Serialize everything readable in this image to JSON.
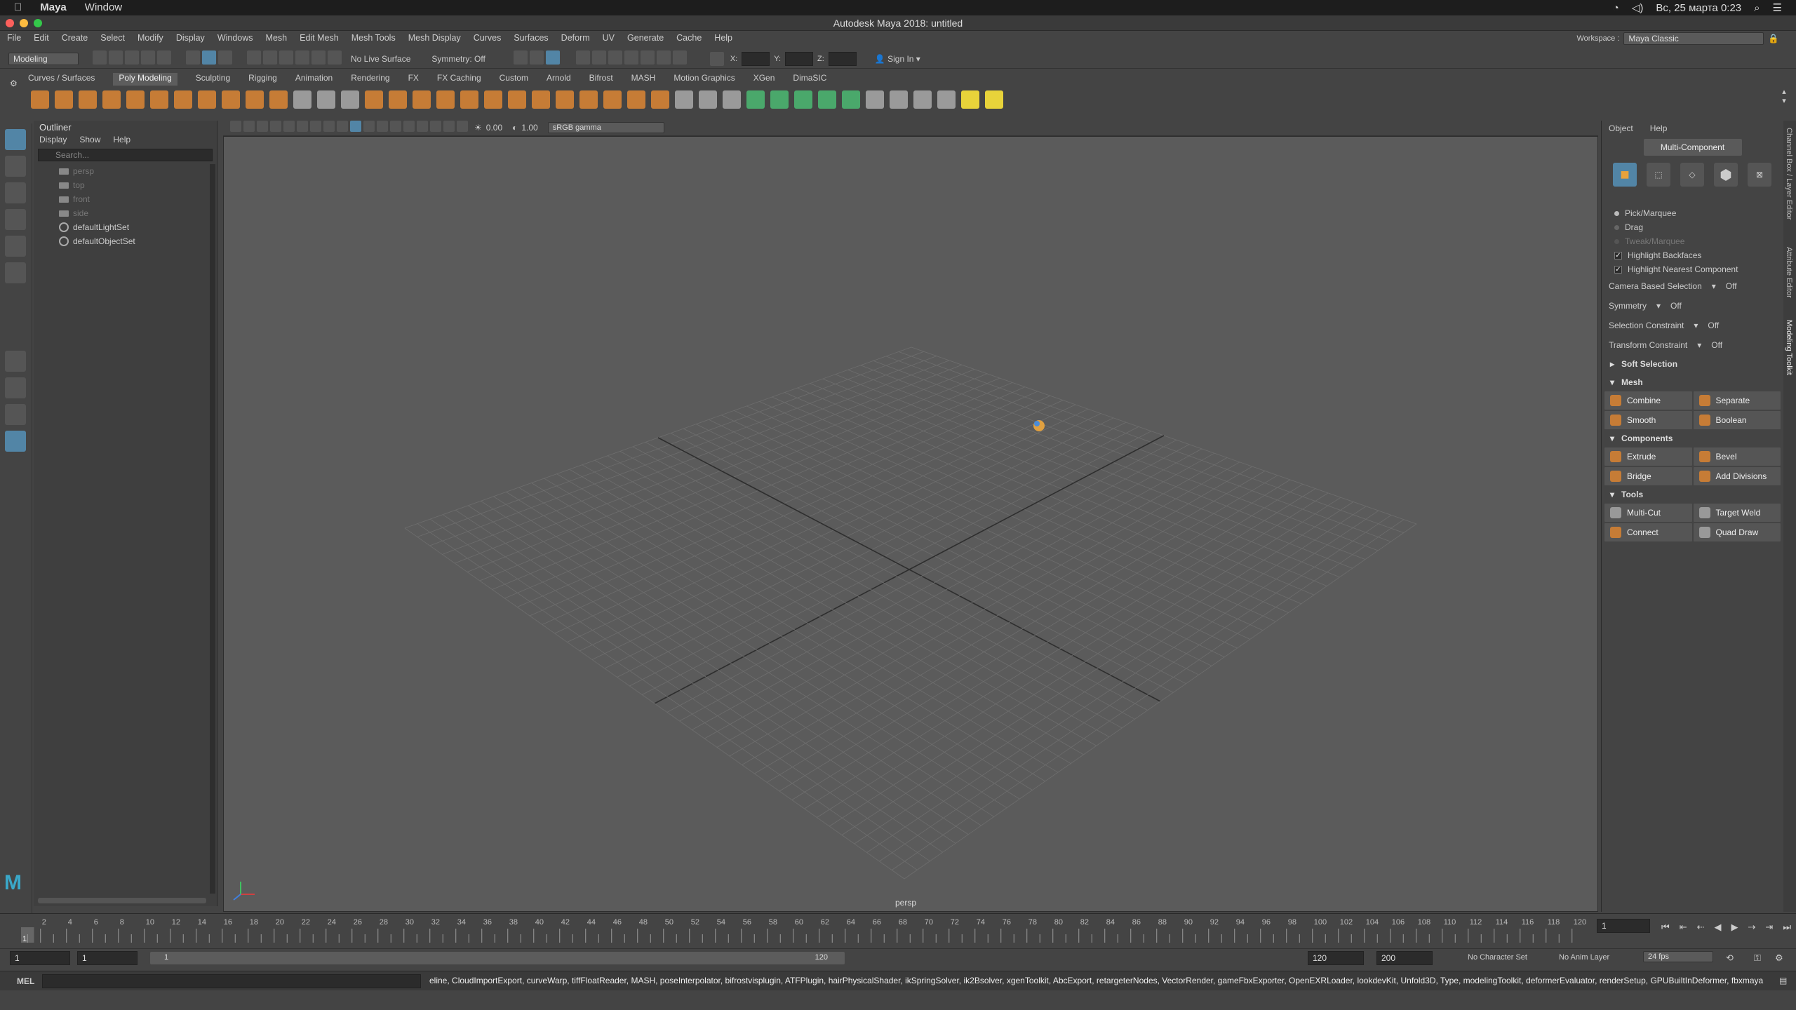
{
  "mac": {
    "app": "Maya",
    "window": "Window",
    "datetime": "Вс, 25 марта 0:23"
  },
  "title": "Autodesk Maya 2018: untitled",
  "menu": [
    "File",
    "Edit",
    "Create",
    "Select",
    "Modify",
    "Display",
    "Windows",
    "Mesh",
    "Edit Mesh",
    "Mesh Tools",
    "Mesh Display",
    "Curves",
    "Surfaces",
    "Deform",
    "UV",
    "Generate",
    "Cache",
    "Help"
  ],
  "workspace": {
    "label": "Workspace :",
    "value": "Maya Classic"
  },
  "status": {
    "mode": "Modeling",
    "live_surface": "No Live Surface",
    "symmetry": "Symmetry: Off",
    "x": "X:",
    "y": "Y:",
    "z": "Z:",
    "sign_in": "Sign In"
  },
  "shelf_tabs": [
    "Curves / Surfaces",
    "Poly Modeling",
    "Sculpting",
    "Rigging",
    "Animation",
    "Rendering",
    "FX",
    "FX Caching",
    "Custom",
    "Arnold",
    "Bifrost",
    "MASH",
    "Motion Graphics",
    "XGen",
    "DimaSIC"
  ],
  "outliner": {
    "title": "Outliner",
    "menu": [
      "Display",
      "Show",
      "Help"
    ],
    "search": "Search...",
    "items": [
      {
        "label": "persp",
        "dim": true,
        "icon": "camera-icon"
      },
      {
        "label": "top",
        "dim": true,
        "icon": "camera-icon"
      },
      {
        "label": "front",
        "dim": true,
        "icon": "camera-icon"
      },
      {
        "label": "side",
        "dim": true,
        "icon": "camera-icon"
      },
      {
        "label": "defaultLightSet",
        "dim": false,
        "icon": "set-icon"
      },
      {
        "label": "defaultObjectSet",
        "dim": false,
        "icon": "set-icon"
      }
    ]
  },
  "viewport": {
    "exposure": "0.00",
    "gamma": "1.00",
    "colorspace": "sRGB gamma",
    "camera": "persp"
  },
  "toolkit": {
    "menu": [
      "Object",
      "Help"
    ],
    "mode": "Multi-Component",
    "selection": [
      "Pick/Marquee",
      "Drag",
      "Tweak/Marquee"
    ],
    "checks": [
      "Highlight Backfaces",
      "Highlight Nearest Component"
    ],
    "settings": [
      {
        "k": "Camera Based Selection",
        "v": "Off"
      },
      {
        "k": "Symmetry",
        "v": "Off"
      },
      {
        "k": "Selection Constraint",
        "v": "Off"
      },
      {
        "k": "Transform Constraint",
        "v": "Off"
      }
    ],
    "soft": "Soft Selection",
    "mesh_title": "Mesh",
    "mesh": [
      "Combine",
      "Separate",
      "Smooth",
      "Boolean"
    ],
    "comp_title": "Components",
    "comp": [
      "Extrude",
      "Bevel",
      "Bridge",
      "Add Divisions"
    ],
    "tools_title": "Tools",
    "tools": [
      "Multi-Cut",
      "Target Weld",
      "Connect",
      "Quad Draw"
    ]
  },
  "sidetabs": [
    "Channel Box / Layer Editor",
    "Attribute Editor",
    "Modeling Toolkit"
  ],
  "time": {
    "ticks": [
      "2",
      "4",
      "6",
      "8",
      "10",
      "12",
      "14",
      "16",
      "18",
      "20",
      "22",
      "24",
      "26",
      "28",
      "30",
      "32",
      "34",
      "36",
      "38",
      "40",
      "42",
      "44",
      "46",
      "48",
      "50",
      "52",
      "54",
      "56",
      "58",
      "60",
      "62",
      "64",
      "66",
      "68",
      "70",
      "72",
      "74",
      "76",
      "78",
      "80",
      "82",
      "84",
      "86",
      "88",
      "90",
      "92",
      "94",
      "96",
      "98",
      "100",
      "102",
      "104",
      "106",
      "108",
      "110",
      "112",
      "114",
      "116",
      "118",
      "120"
    ],
    "current": "1",
    "start": "1",
    "start2": "1",
    "range_start": "1",
    "range_end": "120",
    "end": "120",
    "end2": "200",
    "char_set": "No Character Set",
    "anim_layer": "No Anim Layer",
    "fps": "24 fps"
  },
  "cmd": {
    "lang": "MEL",
    "plugins": "eline, CloudImportExport, curveWarp, tiffFloatReader, MASH, poseInterpolator, bifrostvisplugin, ATFPlugin, hairPhysicalShader, ikSpringSolver, ik2Bsolver, xgenToolkit, AbcExport, retargeterNodes, VectorRender, gameFbxExporter, OpenEXRLoader, lookdevKit, Unfold3D, Type, modelingToolkit, deformerEvaluator, renderSetup, GPUBuiltInDeformer, fbxmaya"
  }
}
